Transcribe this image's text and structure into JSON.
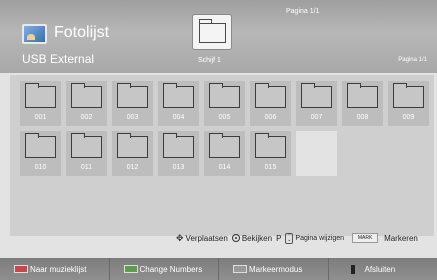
{
  "header": {
    "app_title": "Fotolijst",
    "source": "USB External",
    "drive_label": "Schijf 1",
    "page_indicator_top": "Pagina 1/1",
    "page_indicator_right": "Pagina 1/1"
  },
  "folders": [
    {
      "label": "001"
    },
    {
      "label": "002"
    },
    {
      "label": "003"
    },
    {
      "label": "004"
    },
    {
      "label": "005"
    },
    {
      "label": "006"
    },
    {
      "label": "007"
    },
    {
      "label": "008"
    },
    {
      "label": "009"
    },
    {
      "label": "010"
    },
    {
      "label": "011"
    },
    {
      "label": "012"
    },
    {
      "label": "013"
    },
    {
      "label": "014"
    },
    {
      "label": "015"
    }
  ],
  "hints": {
    "move": "Verplaatsen",
    "view": "Bekijken",
    "page_prefix": "P",
    "page_change": "Pagina wijzigen",
    "mark_key": "MARK",
    "mark": "Markeren"
  },
  "footer": {
    "red": "Naar muzieklijst",
    "green": "Change Numbers",
    "yellow": "Markeermodus",
    "blue": "Afsluiten"
  },
  "colors": {
    "header_bg": "#a8a8a8",
    "grid_bg": "#cfcfcf",
    "footer_bg": "#878787",
    "key_red": "#c24a4a",
    "key_green": "#5b9d4f"
  }
}
